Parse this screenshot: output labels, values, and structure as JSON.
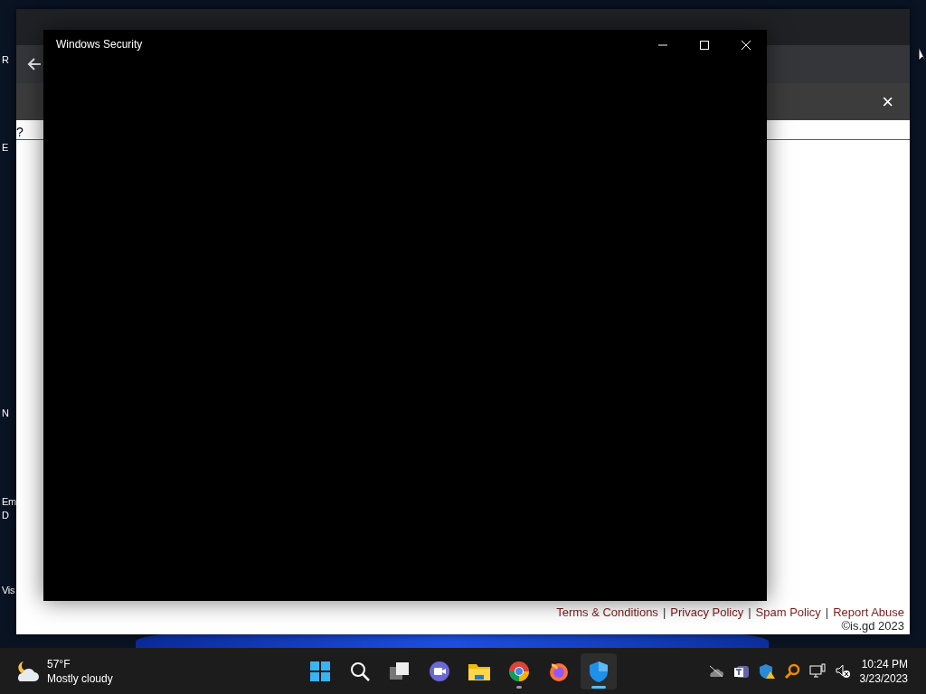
{
  "desktop_labels": [
    {
      "text": "R"
    },
    {
      "text": "E"
    },
    {
      "text": "N"
    },
    {
      "text": "Em"
    },
    {
      "text": "D"
    },
    {
      "text": "Vis"
    }
  ],
  "browser": {
    "info_bar_close": "×",
    "page": {
      "help_mark": "?",
      "footer_items": [
        {
          "kind": "link",
          "text": "Terms & Conditions"
        },
        {
          "kind": "separator",
          "text": "|"
        },
        {
          "kind": "link",
          "text": "Privacy Policy"
        },
        {
          "kind": "separator",
          "text": "|"
        },
        {
          "kind": "link",
          "text": "Spam Policy"
        },
        {
          "kind": "separator",
          "text": "|"
        },
        {
          "kind": "link",
          "text": "Report Abuse"
        }
      ],
      "copyright": "©is.gd 2023"
    }
  },
  "dialog": {
    "title": "Windows Security"
  },
  "taskbar": {
    "weather": {
      "temperature": "57°F",
      "condition": "Mostly cloudy"
    },
    "apps": [
      {
        "kind": "start",
        "running": false,
        "selected": false
      },
      {
        "kind": "search",
        "running": false,
        "selected": false
      },
      {
        "kind": "task-view",
        "running": false,
        "selected": false
      },
      {
        "kind": "chat",
        "running": false,
        "selected": false
      },
      {
        "kind": "folder",
        "running": false,
        "selected": false
      },
      {
        "kind": "chrome",
        "running": true,
        "selected": false
      },
      {
        "kind": "firefox",
        "running": false,
        "selected": false
      },
      {
        "kind": "shield",
        "running": true,
        "selected": true
      }
    ],
    "clock": {
      "time": "10:24 PM",
      "date": "3/23/2023"
    }
  }
}
